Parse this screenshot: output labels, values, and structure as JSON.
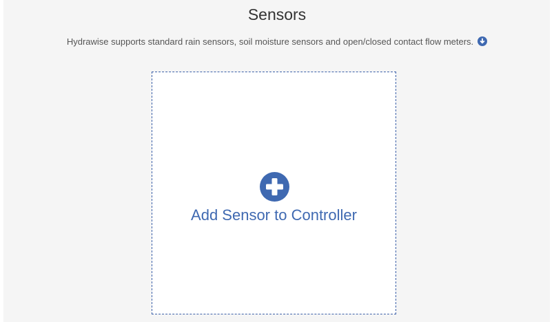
{
  "header": {
    "title": "Sensors",
    "intro": "Hydrawise supports standard rain sensors, soil moisture sensors and open/closed contact flow meters."
  },
  "icons": {
    "info_toggle": "chevron-down-circle-icon",
    "add": "plus-circle-icon"
  },
  "add_card": {
    "label": "Add Sensor to Controller"
  },
  "colors": {
    "accent": "#3f69b1",
    "panel_background": "#f5f5f5",
    "title_text": "#333333"
  }
}
